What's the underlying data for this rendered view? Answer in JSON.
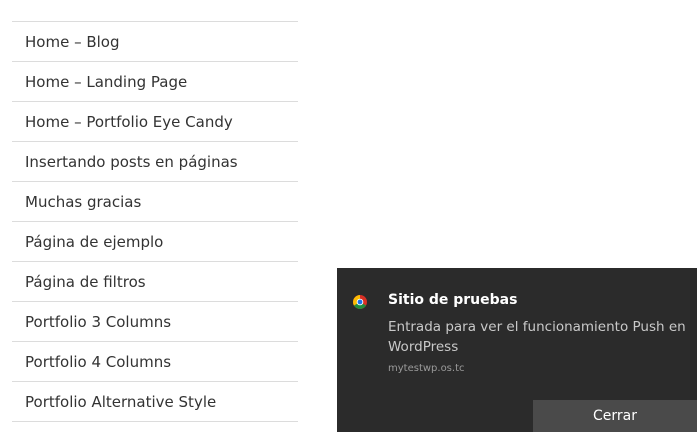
{
  "pages": [
    "Home – Blog",
    "Home – Landing Page",
    "Home – Portfolio Eye Candy",
    "Insertando posts en páginas",
    "Muchas gracias",
    "Página de ejemplo",
    "Página de filtros",
    "Portfolio 3 Columns",
    "Portfolio 4 Columns",
    "Portfolio Alternative Style"
  ],
  "notification": {
    "icon": "chrome-icon",
    "title": "Sitio de pruebas",
    "body": "Entrada para ver el funcionamiento Push en WordPress",
    "source": "mytestwp.os.tc",
    "close_label": "Cerrar"
  }
}
